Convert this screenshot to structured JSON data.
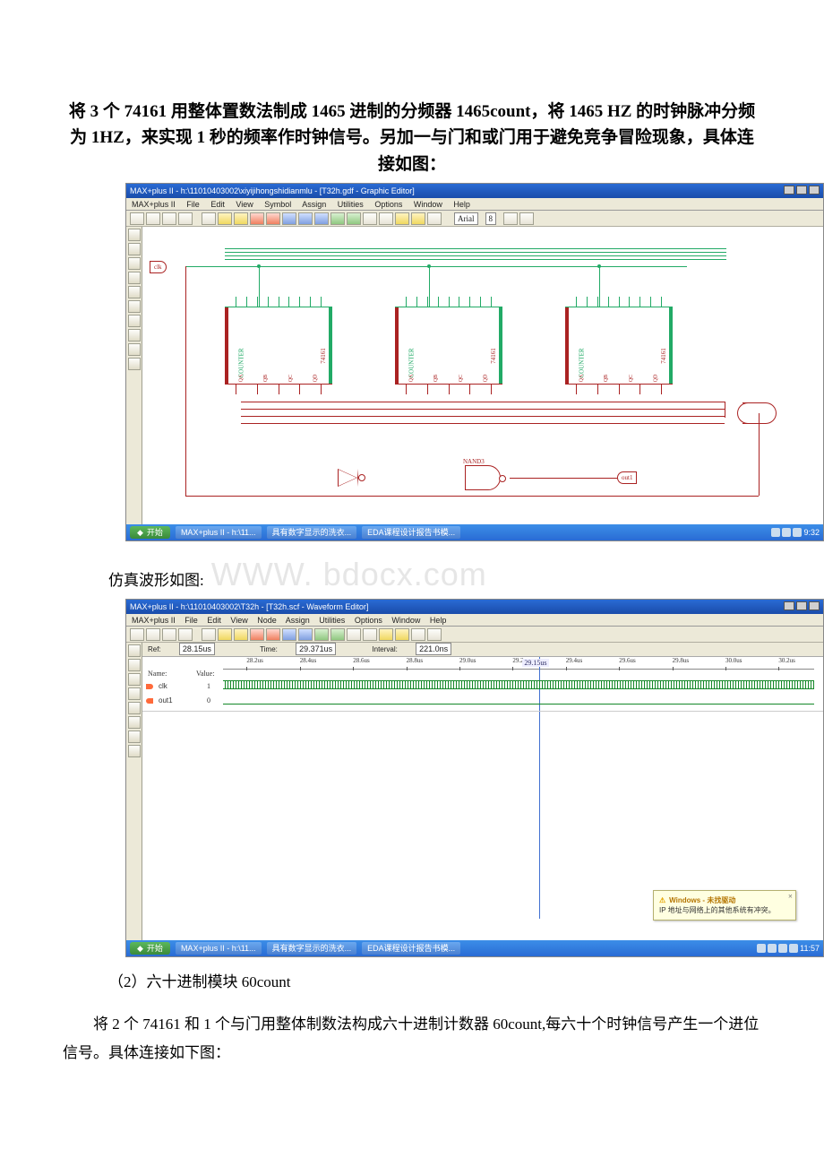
{
  "heading": "将 3 个 74161 用整体置数法制成 1465 进制的分频器 1465count，将 1465 HZ 的时钟脉冲分频为 1HZ，来实现 1 秒的频率作时钟信号。另加一与门和或门用于避免竞争冒险现象，具体连接如图：",
  "caption_waveform_line1": "仿真波形如图:",
  "watermark_text": "WWW. bdocx.com",
  "section2_title": "（2）六十进制模块 60count",
  "section2_body": "将 2 个 74161 和 1 个与门用整体制数法构成六十进制计数器 60count,每六十个时钟信号产生一个进位信号。具体连接如下图：",
  "shot1": {
    "title": "MAX+plus II - h:\\11010403002\\xiyijihongshidianmlu - [T32h.gdf - Graphic Editor]",
    "menu": [
      "MAX+plus II",
      "File",
      "Edit",
      "View",
      "Symbol",
      "Assign",
      "Utilities",
      "Options",
      "Window",
      "Help"
    ],
    "font_sel": "Arial",
    "size_sel": "8",
    "io_clk": "clk",
    "io_out": "out1",
    "chip_label": "COUNTER",
    "ic_label": "74161",
    "nand_lbl": "NAND3",
    "or_lbl": "OR2",
    "not_lbl": "NOT",
    "pin_q": [
      "QA",
      "QB",
      "QC",
      "QD"
    ],
    "taskbar": {
      "start": "开始",
      "tasks": [
        "MAX+plus II - h:\\11...",
        "具有数字显示的洗衣...",
        "EDA课程设计报告书模..."
      ],
      "time": "9:32"
    }
  },
  "shot2": {
    "title": "MAX+plus II - h:\\11010403002\\T32h - [T32h.scf - Waveform Editor]",
    "menu": [
      "MAX+plus II",
      "File",
      "Edit",
      "View",
      "Node",
      "Assign",
      "Utilities",
      "Options",
      "Window",
      "Help"
    ],
    "ref_lbl": "Ref:",
    "ref_val": "28.15us",
    "time_lbl": "Time:",
    "time_val": "29.371us",
    "int_lbl": "Interval:",
    "int_val": "221.0ns",
    "cursor_lbl": "29.15us",
    "col_name": "Name:",
    "col_value": "Value:",
    "signals": [
      {
        "name": "clk",
        "dir": "in",
        "value": "1",
        "kind": "clock"
      },
      {
        "name": "out1",
        "dir": "out",
        "value": "0",
        "kind": "low"
      }
    ],
    "ticks": [
      "28.2us",
      "28.4us",
      "28.6us",
      "28.8us",
      "29.0us",
      "29.2us",
      "29.4us",
      "29.6us",
      "29.8us",
      "30.0us",
      "30.2us"
    ],
    "tooltip": {
      "title": "Windows - 未找驱动",
      "body": "IP 地址与网络上的其他系统有冲突。"
    },
    "taskbar": {
      "start": "开始",
      "tasks": [
        "MAX+plus II - h:\\11...",
        "具有数字显示的洗衣...",
        "EDA课程设计报告书模..."
      ],
      "time": "11:57"
    }
  }
}
